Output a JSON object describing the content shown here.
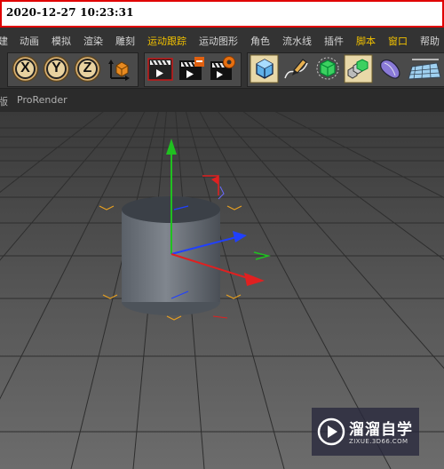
{
  "timestamp": "2020-12-27 10:23:31",
  "menu": {
    "items": [
      {
        "label": "建",
        "highlight": false
      },
      {
        "label": "动画",
        "highlight": false
      },
      {
        "label": "模拟",
        "highlight": false
      },
      {
        "label": "渲染",
        "highlight": false
      },
      {
        "label": "雕刻",
        "highlight": false
      },
      {
        "label": "运动跟踪",
        "highlight": true
      },
      {
        "label": "运动图形",
        "highlight": false
      },
      {
        "label": "角色",
        "highlight": false
      },
      {
        "label": "流水线",
        "highlight": false
      },
      {
        "label": "插件",
        "highlight": false
      },
      {
        "label": "脚本",
        "highlight": true
      },
      {
        "label": "窗口",
        "highlight": true
      },
      {
        "label": "帮助",
        "highlight": false
      }
    ]
  },
  "toolbar": {
    "axis_x": "X",
    "axis_y": "Y",
    "axis_z": "Z"
  },
  "subbar": {
    "left_label": "版",
    "prorender_label": "ProRender"
  },
  "watermark": {
    "title": "溜溜自学",
    "subtitle": "ZIXUE.3D66.COM"
  },
  "colors": {
    "menu_highlight": "#f0c000",
    "timestamp_border": "#e00000",
    "axis_x": "#e02020",
    "axis_y": "#20c020",
    "axis_z": "#2040ff"
  }
}
